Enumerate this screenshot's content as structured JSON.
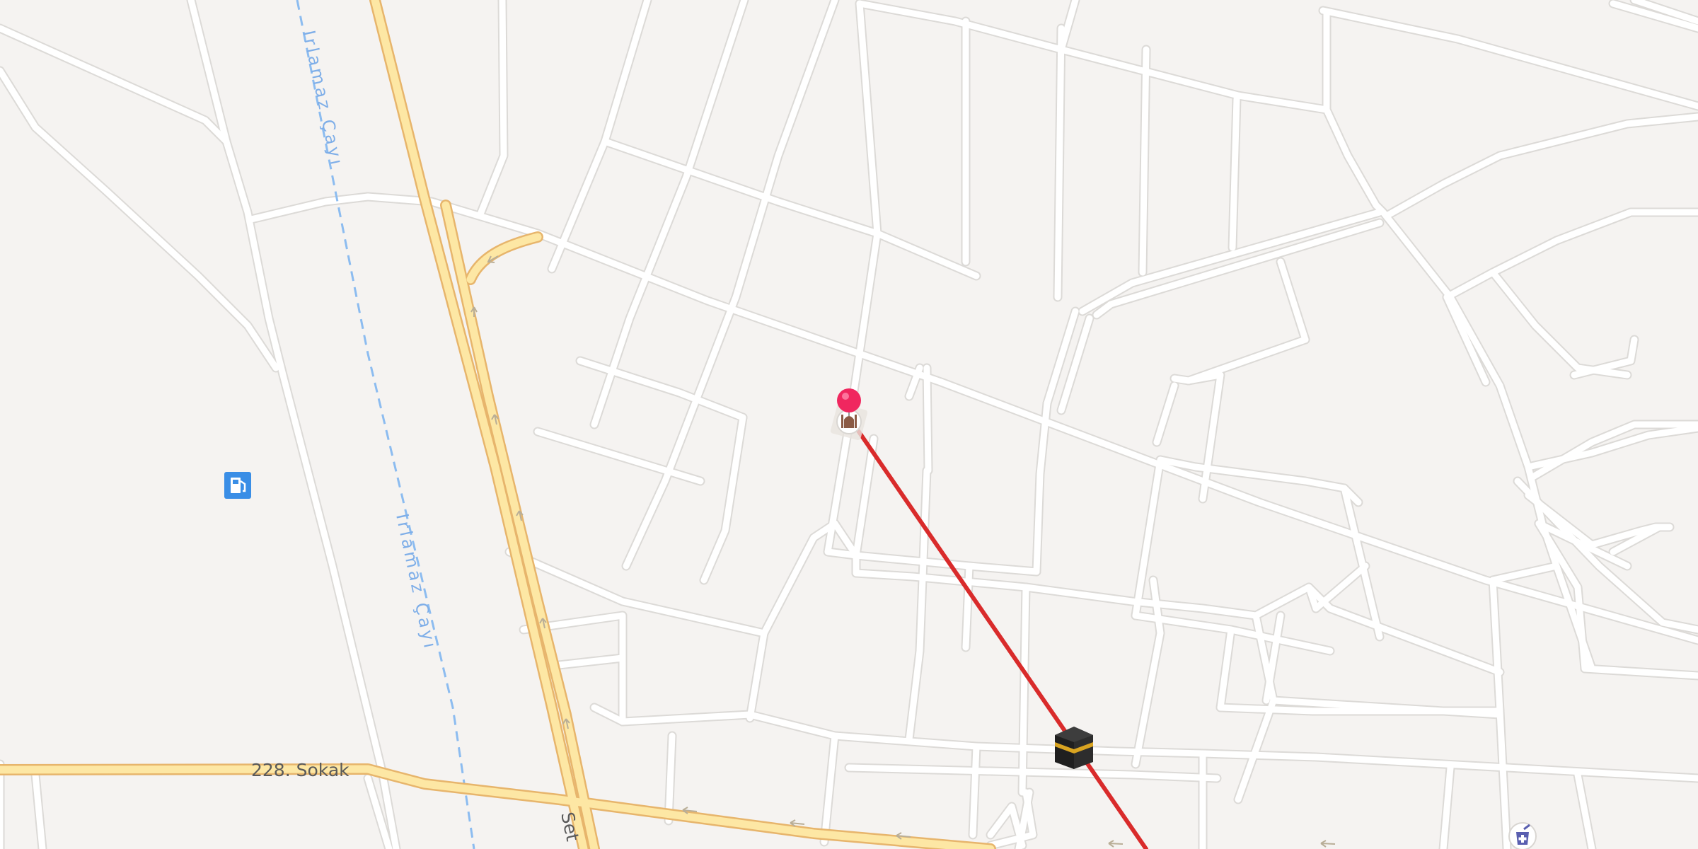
{
  "map": {
    "colors": {
      "land": "#f5f3f1",
      "minor_road": "#ffffff",
      "minor_road_casing": "#d8d6d3",
      "major_road": "#fde7a4",
      "major_road_casing": "#e7b56c",
      "river": "#8cbcf0",
      "river_label": "#7eaee8",
      "route": "#d92b2b",
      "pin": "#f0275f",
      "road_label": "#5a5a5a",
      "arrow": "#b9ae97"
    },
    "labels": {
      "river_upper": "Irlamaz Çayı",
      "river_lower": "Irlamaz Çayı",
      "street_sokak": "228. Sokak",
      "street_bottom": "Set"
    },
    "icons": {
      "fuel": "fuel-station-icon",
      "mosque": "mosque-icon",
      "kaaba": "kaaba-icon",
      "pharmacy": "pharmacy-icon",
      "pin": "location-pin-icon"
    },
    "route": {
      "description_color": "red",
      "kind": "qibla-direction-line"
    }
  }
}
